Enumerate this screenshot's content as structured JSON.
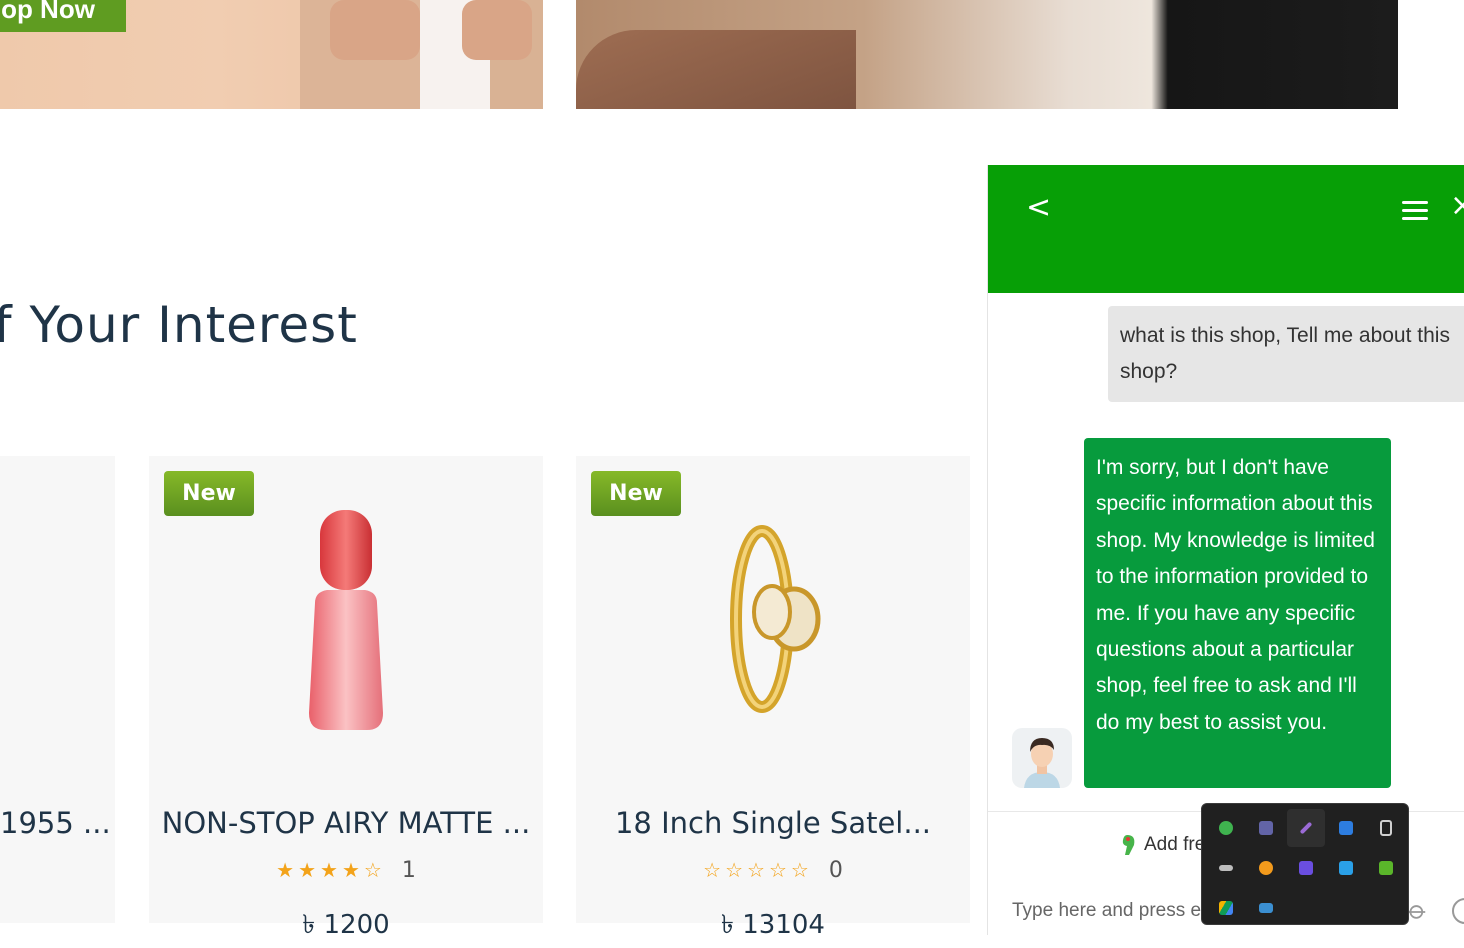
{
  "hero": {
    "left_button_label": "op Now"
  },
  "section": {
    "title": "f Your Interest"
  },
  "products": [
    {
      "badge": "",
      "name": "1955 ...",
      "rating_count": "",
      "price": ""
    },
    {
      "badge": "New",
      "name": "NON-STOP AIRY MATTE ...",
      "rating": 4,
      "stars_filled": "★★★★",
      "stars_empty": "☆",
      "rating_count": "1",
      "price": "৳ 1200"
    },
    {
      "badge": "New",
      "name": "18 Inch Single Satel...",
      "rating": 0,
      "stars_filled": "",
      "stars_empty": "☆☆☆☆☆",
      "rating_count": "0",
      "price": "৳ 13104"
    }
  ],
  "chat": {
    "back_icon": "chevron-left-icon",
    "back_glyph": "<",
    "menu_icon": "hamburger-icon",
    "close_glyph": "×",
    "user_message": "what is this shop, Tell me about this shop?",
    "bot_message": "I'm sorry, but I don't have specific information about this shop. My knowledge is limited to the information provided to me. If you have any specific questions about a particular shop, feel free to ask and I'll do my best to assist you.",
    "add_free_label": "Add fre",
    "input_placeholder": "Type here and press e",
    "accent_color": "#079f06",
    "bot_bubble_color": "#079b3d"
  },
  "tray": {
    "icons": [
      {
        "name": "wechat-icon",
        "color": "#3fb34f"
      },
      {
        "name": "teams-icon",
        "color": "#6264a7"
      },
      {
        "name": "pen-icon",
        "color": "#9b6bd6"
      },
      {
        "name": "defender-warning-icon",
        "color": "#2d7de0"
      },
      {
        "name": "usb-eject-icon",
        "color": "#d0d0d0"
      },
      {
        "name": "hidden-eye-icon",
        "color": "#bdbdbd"
      },
      {
        "name": "orange-update-icon",
        "color": "#f29a1c"
      },
      {
        "name": "headset-icon",
        "color": "#6a4ee0"
      },
      {
        "name": "blue-app-icon",
        "color": "#2aa0e8"
      },
      {
        "name": "green-play-icon",
        "color": "#5ab62a"
      },
      {
        "name": "google-drive-icon",
        "color": "#f4b400"
      },
      {
        "name": "monitor-icon",
        "color": "#3b8fd1"
      }
    ]
  }
}
